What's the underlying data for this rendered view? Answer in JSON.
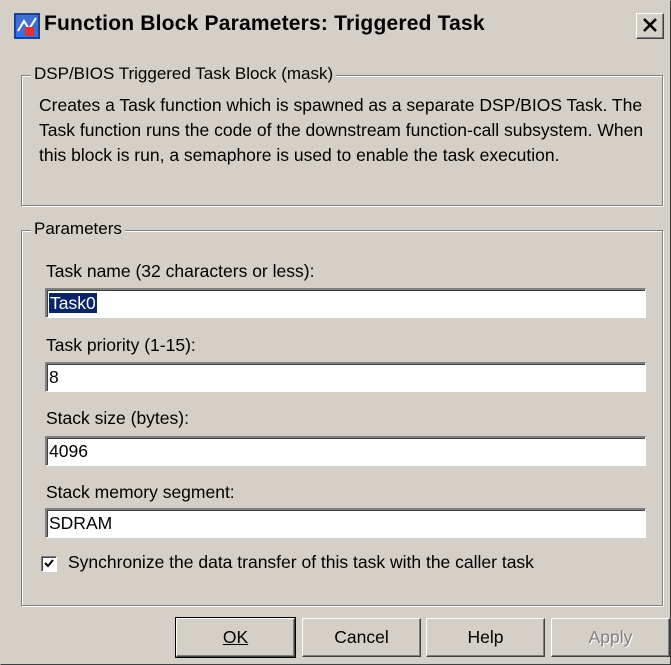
{
  "window": {
    "title": "Function Block Parameters: Triggered Task",
    "icon": "simulink-block-icon"
  },
  "description": {
    "legend": "DSP/BIOS Triggered Task Block (mask)",
    "text": "Creates a Task function which is spawned as a separate DSP/BIOS Task. The Task function runs the code of the downstream function-call subsystem. When this block is run, a semaphore is used to enable the task execution."
  },
  "parameters": {
    "legend": "Parameters",
    "task_name_label": "Task name (32 characters or less):",
    "task_name_value": "Task0",
    "task_priority_label": "Task priority (1-15):",
    "task_priority_value": "8",
    "stack_size_label": "Stack size (bytes):",
    "stack_size_value": "4096",
    "stack_memory_label": "Stack memory segment:",
    "stack_memory_value": "SDRAM",
    "sync_label": "Synchronize the data transfer of this task with the caller task",
    "sync_checked": true
  },
  "buttons": {
    "ok": "OK",
    "cancel": "Cancel",
    "help": "Help",
    "apply": "Apply"
  }
}
